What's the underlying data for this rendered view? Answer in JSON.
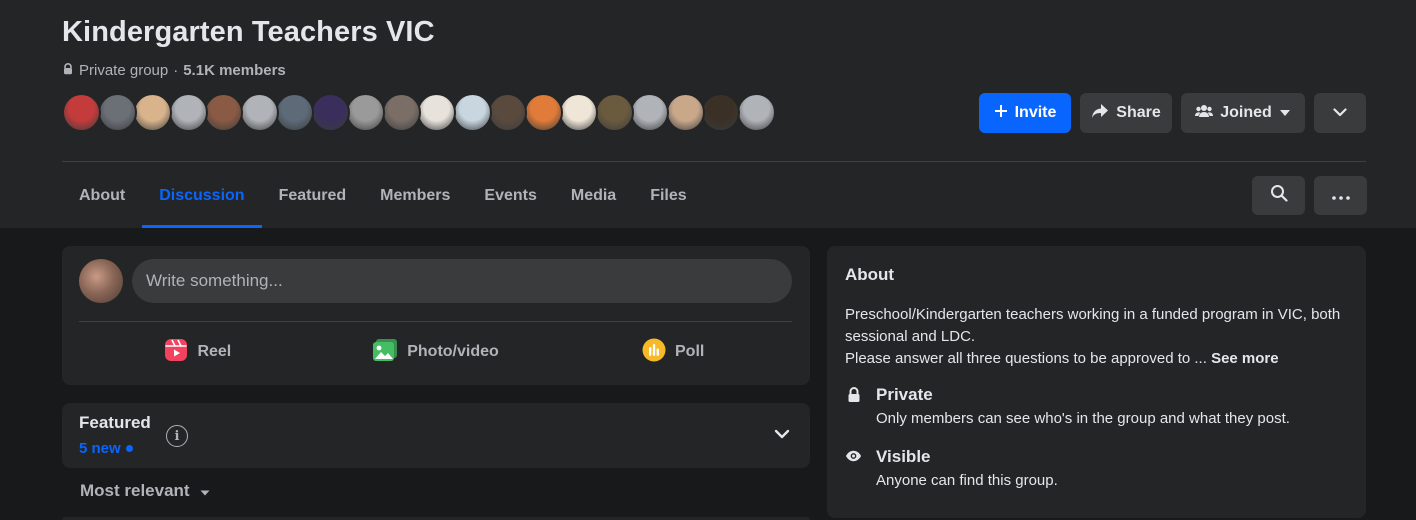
{
  "group": {
    "title": "Kindergarten Teachers VIC",
    "privacy": "Private group",
    "separator": "·",
    "members": "5.1K members"
  },
  "avatar_colors": [
    "#c43b3b",
    "#6b6f76",
    "#d9b38c",
    "#b0b3b8",
    "#8a5a44",
    "#b0b3b8",
    "#5d6a78",
    "#3a2f5c",
    "#9a9a9a",
    "#7a6e66",
    "#e8e2dc",
    "#c8d6e0",
    "#5a4a3e",
    "#e07b39",
    "#f0e6d8",
    "#6b5b3e",
    "#b0b3b8",
    "#c9a88a",
    "#3b3026",
    "#b0b3b8"
  ],
  "actions": {
    "invite": "Invite",
    "share": "Share",
    "joined": "Joined"
  },
  "tabs": [
    "About",
    "Discussion",
    "Featured",
    "Members",
    "Events",
    "Media",
    "Files"
  ],
  "composer": {
    "placeholder": "Write something...",
    "reel": "Reel",
    "photo": "Photo/video",
    "poll": "Poll"
  },
  "featured": {
    "title": "Featured",
    "new": "5 new"
  },
  "sort": {
    "label": "Most relevant"
  },
  "about": {
    "title": "About",
    "line1": "Preschool/Kindergarten teachers working in a funded program in VIC, both sessional and LDC.",
    "line2": "Please answer all three questions to be approved to ...",
    "see_more": "See more",
    "private_title": "Private",
    "private_desc": "Only members can see who's in the group and what they post.",
    "visible_title": "Visible",
    "visible_desc": "Anyone can find this group."
  },
  "colors": {
    "accent": "#0866ff",
    "reel_icon": "#f3425f",
    "photo_icon": "#45bd62",
    "poll_icon": "#f7b928"
  }
}
